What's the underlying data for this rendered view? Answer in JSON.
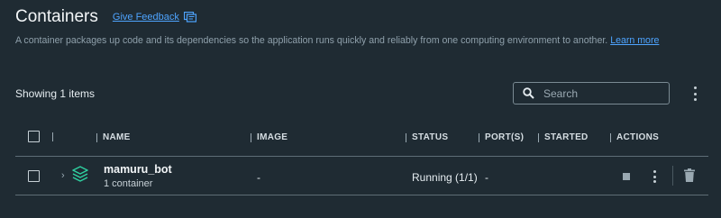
{
  "header": {
    "title": "Containers",
    "feedback_label": "Give Feedback",
    "feedback_icon": "feedback-icon",
    "description": "A container packages up code and its dependencies so the application runs quickly and reliably from one computing environment to another.",
    "learn_more": "Learn more"
  },
  "toolbar": {
    "showing": "Showing 1 items",
    "search_placeholder": "Search",
    "search_icon": "search-icon",
    "more_icon": "kebab-icon"
  },
  "table": {
    "columns": [
      "NAME",
      "IMAGE",
      "STATUS",
      "PORT(S)",
      "STARTED",
      "ACTIONS"
    ],
    "rows": [
      {
        "name": "mamuru_bot",
        "subtitle": "1 container",
        "image": "-",
        "status": "Running (1/1)",
        "ports": "-",
        "started": "",
        "icon": "stack-icon",
        "actions": [
          "stop-icon",
          "kebab-icon",
          "trash-icon"
        ]
      }
    ]
  },
  "colors": {
    "background": "#1f2b33",
    "link": "#4ea4ff",
    "stack_icon": "#2fd0a0"
  }
}
